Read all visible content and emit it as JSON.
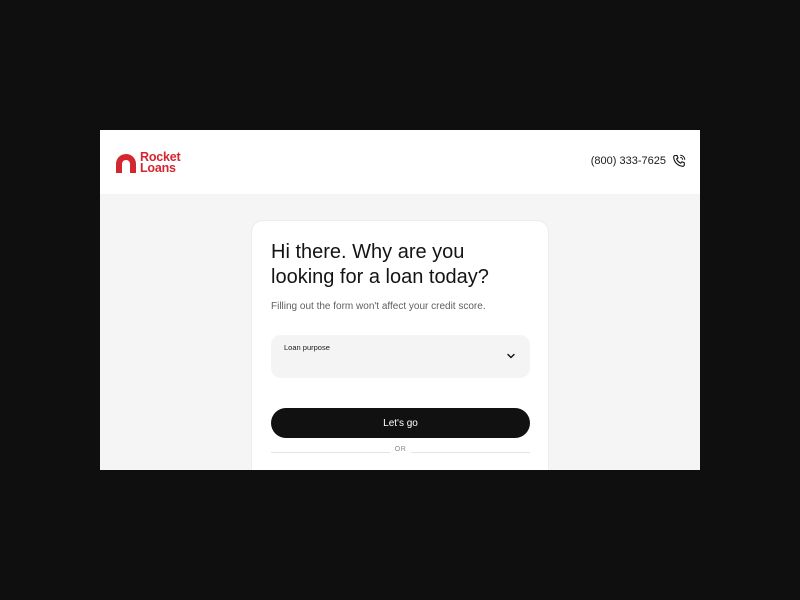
{
  "header": {
    "logo_line1": "Rocket",
    "logo_line2": "Loans",
    "phone": "(800) 333-7625",
    "phone_icon": "phone-icon"
  },
  "form": {
    "title": "Hi there. Why are you looking for a loan today?",
    "subtitle": "Filling out the form won't affect your credit score.",
    "loan_purpose_label": "Loan purpose",
    "chevron_icon": "chevron-down-icon",
    "submit_label": "Let's go",
    "divider_text": "OR"
  },
  "colors": {
    "brand_red": "#d4262f",
    "button_bg": "#111111",
    "page_bg": "#f5f5f5"
  }
}
